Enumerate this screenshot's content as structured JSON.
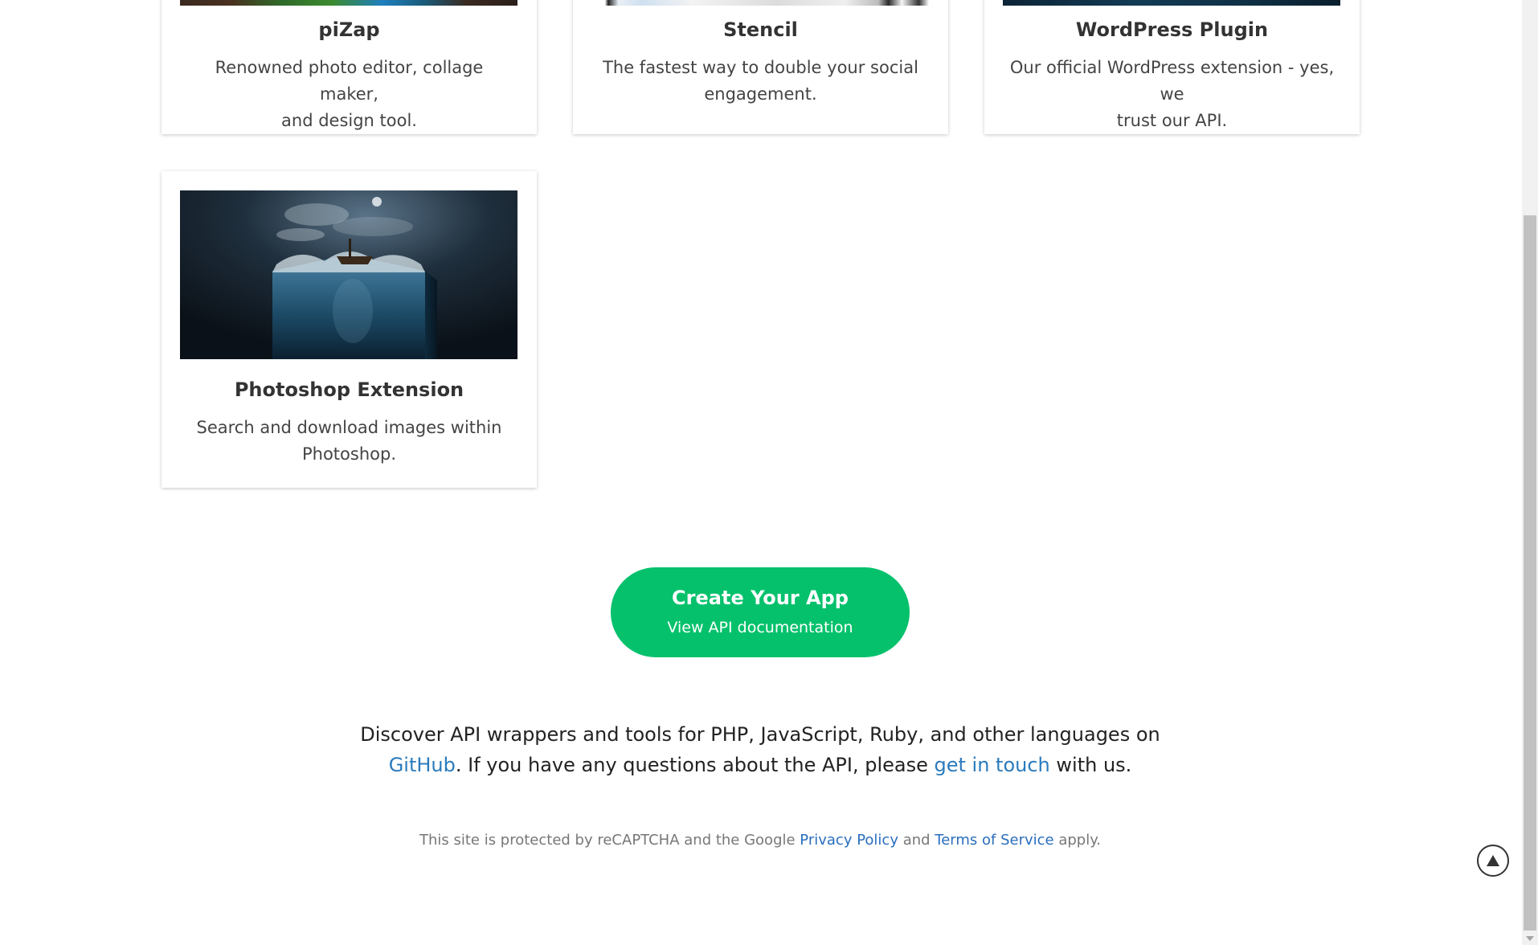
{
  "cards": [
    {
      "title": "piZap",
      "description_line1": "Renowned photo editor, collage maker,",
      "description_line2": "and design tool.",
      "thumb": "pizap-image"
    },
    {
      "title": "Stencil",
      "description_line1": "The fastest way to double your social",
      "description_line2": "engagement.",
      "thumb": "stencil-image"
    },
    {
      "title": "WordPress Plugin",
      "description_line1": "Our official WordPress extension - yes, we",
      "description_line2": "trust our API.",
      "thumb": "wordpress-image"
    },
    {
      "title": "Photoshop Extension",
      "description_line1": "Search and download images within",
      "description_line2": "Photoshop.",
      "thumb": "photoshop-image"
    }
  ],
  "cta": {
    "title": "Create Your App",
    "subtitle": "View API documentation",
    "color": "#05c16c"
  },
  "discover": {
    "line1": "Discover API wrappers and tools for PHP, JavaScript, Ruby, and other languages on",
    "github_link": "GitHub",
    "text_mid": ". If you have any questions about the API, please ",
    "contact_link": "get in touch",
    "text_end": " with us."
  },
  "recaptcha": {
    "text_start": "This site is protected by reCAPTCHA and the Google ",
    "privacy_link": "Privacy Policy",
    "text_mid": " and ",
    "terms_link": "Terms of Service",
    "text_end": " apply."
  },
  "scroll_top": {
    "icon": "arrow-up-icon"
  },
  "colors": {
    "link": "#2a7bbd",
    "accent": "#05c16c"
  }
}
